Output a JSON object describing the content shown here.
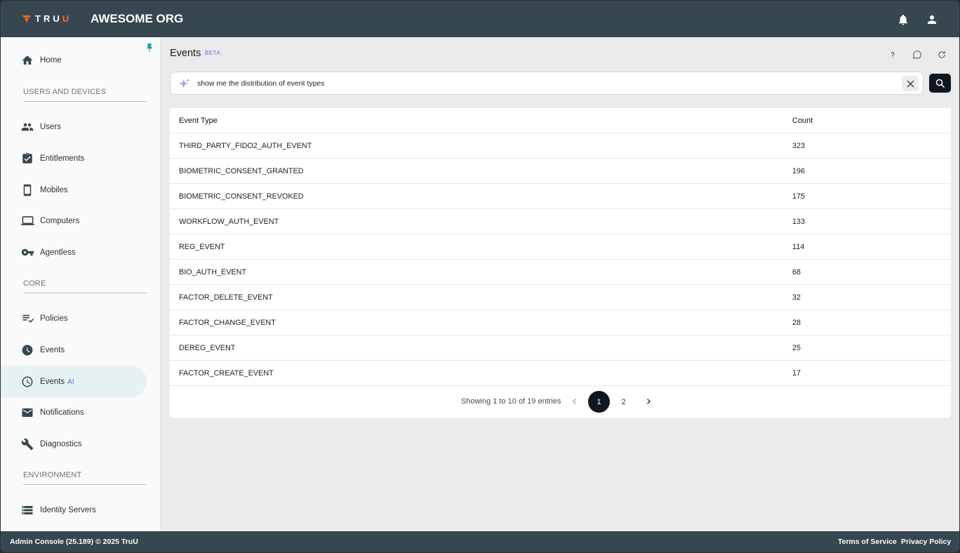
{
  "header": {
    "logo_text": "TRUU",
    "org_name": "AWESOME ORG"
  },
  "sidebar": {
    "items": [
      {
        "label": "Home",
        "icon": "home-icon"
      },
      {
        "label": "Users",
        "icon": "users-icon"
      },
      {
        "label": "Entitlements",
        "icon": "assignment-check-icon"
      },
      {
        "label": "Mobiles",
        "icon": "smartphone-icon"
      },
      {
        "label": "Computers",
        "icon": "laptop-icon"
      },
      {
        "label": "Agentless",
        "icon": "key-icon"
      },
      {
        "label": "Policies",
        "icon": "checklist-icon"
      },
      {
        "label": "Events",
        "icon": "clock-icon"
      },
      {
        "label": "Events",
        "suffix": "AI",
        "icon": "clock-icon",
        "active": true
      },
      {
        "label": "Notifications",
        "icon": "mail-icon"
      },
      {
        "label": "Diagnostics",
        "icon": "wrench-icon"
      },
      {
        "label": "Identity Servers",
        "icon": "server-list-icon"
      }
    ],
    "sections": [
      "USERS AND DEVICES",
      "CORE",
      "ENVIRONMENT"
    ]
  },
  "main": {
    "title": "Events",
    "badge": "BETA",
    "search": {
      "value": "show me the distribution of event types"
    },
    "table": {
      "columns": [
        "Event Type",
        "Count"
      ],
      "rows": [
        [
          "THIRD_PARTY_FIDO2_AUTH_EVENT",
          "323"
        ],
        [
          "BIOMETRIC_CONSENT_GRANTED",
          "196"
        ],
        [
          "BIOMETRIC_CONSENT_REVOKED",
          "175"
        ],
        [
          "WORKFLOW_AUTH_EVENT",
          "133"
        ],
        [
          "REG_EVENT",
          "114"
        ],
        [
          "BIO_AUTH_EVENT",
          "68"
        ],
        [
          "FACTOR_DELETE_EVENT",
          "32"
        ],
        [
          "FACTOR_CHANGE_EVENT",
          "28"
        ],
        [
          "DEREG_EVENT",
          "25"
        ],
        [
          "FACTOR_CREATE_EVENT",
          "17"
        ]
      ]
    },
    "pagination": {
      "info": "Showing 1 to 10 of 19 entries",
      "pages": [
        "1",
        "2"
      ],
      "current": "1"
    }
  },
  "footer": {
    "left": "Admin Console (25.189) © 2025 TruU",
    "terms": "Terms of Service",
    "privacy": "Privacy Policy"
  },
  "colors": {
    "header_bg": "#37474f",
    "accent_orange": "#ff6a1a",
    "beta_purple": "#7c5cf0",
    "active_nav_bg": "#e6f1f3",
    "primary_dark": "#0f1720"
  }
}
